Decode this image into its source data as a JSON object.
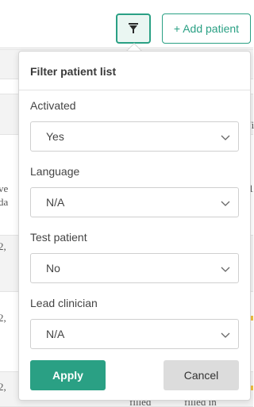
{
  "toolbar": {
    "filter_icon": "filter-funnel-icon",
    "add_label": "+ Add patient"
  },
  "background_fragments": {
    "row1_a": "ve",
    "row1_b": "da",
    "row1_right": "1",
    "row2": "2,",
    "row3": "2,",
    "row4": "2,",
    "bottom_col1": "filled",
    "bottom_col2": "filled in",
    "top_right": "/i"
  },
  "filter": {
    "title": "Filter patient list",
    "fields": [
      {
        "label": "Activated",
        "value": "Yes"
      },
      {
        "label": "Language",
        "value": "N/A"
      },
      {
        "label": "Test patient",
        "value": "No"
      },
      {
        "label": "Lead clinician",
        "value": "N/A"
      }
    ],
    "apply_label": "Apply",
    "cancel_label": "Cancel"
  },
  "colors": {
    "accent": "#2aa084",
    "cancel_bg": "#dcdcdc",
    "row_band": "#f3f3f3"
  }
}
